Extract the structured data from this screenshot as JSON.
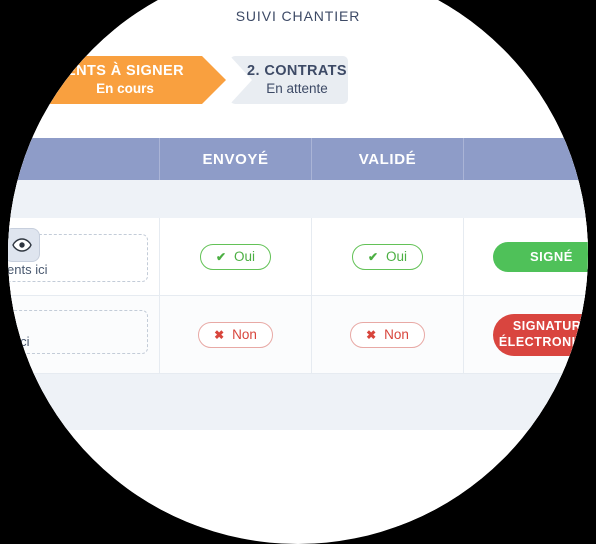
{
  "page": {
    "title": "SUIVI CHANTIER",
    "background_color": "#000000",
    "surface_color": "#ffffff"
  },
  "stepper": {
    "steps": [
      {
        "title": "ENTS À SIGNER",
        "status": "En cours",
        "state": "active",
        "color": "#f9a03f"
      },
      {
        "title": "2. CONTRATS",
        "status": "En attente",
        "state": "pending",
        "color": "#e9edf2"
      }
    ]
  },
  "table": {
    "header_color": "#8e9cc8",
    "columns": [
      {
        "key": "document",
        "label": ""
      },
      {
        "key": "envoye",
        "label": "ENVOYÉ"
      },
      {
        "key": "valide",
        "label": "VALIDÉ"
      },
      {
        "key": "action",
        "label": ""
      }
    ],
    "rows": [
      {
        "dropzone_text": "uments ici",
        "envoye": {
          "label": "Oui",
          "icon": "check-icon",
          "state": "yes"
        },
        "valide": {
          "label": "Oui",
          "icon": "check-icon",
          "state": "yes"
        },
        "action": {
          "label": "SIGNÉ",
          "color": "#4fc159"
        }
      },
      {
        "dropzone_text": "ents ici",
        "envoye": {
          "label": "Non",
          "icon": "cross-icon",
          "state": "no"
        },
        "valide": {
          "label": "Non",
          "icon": "cross-icon",
          "state": "no"
        },
        "action": {
          "label_line1": "SIGNATURE",
          "label_line2": "ÉLECTRONIQUE",
          "color": "#d9453f"
        }
      }
    ]
  },
  "sidebar": {
    "preview_icon": "eye-icon"
  }
}
